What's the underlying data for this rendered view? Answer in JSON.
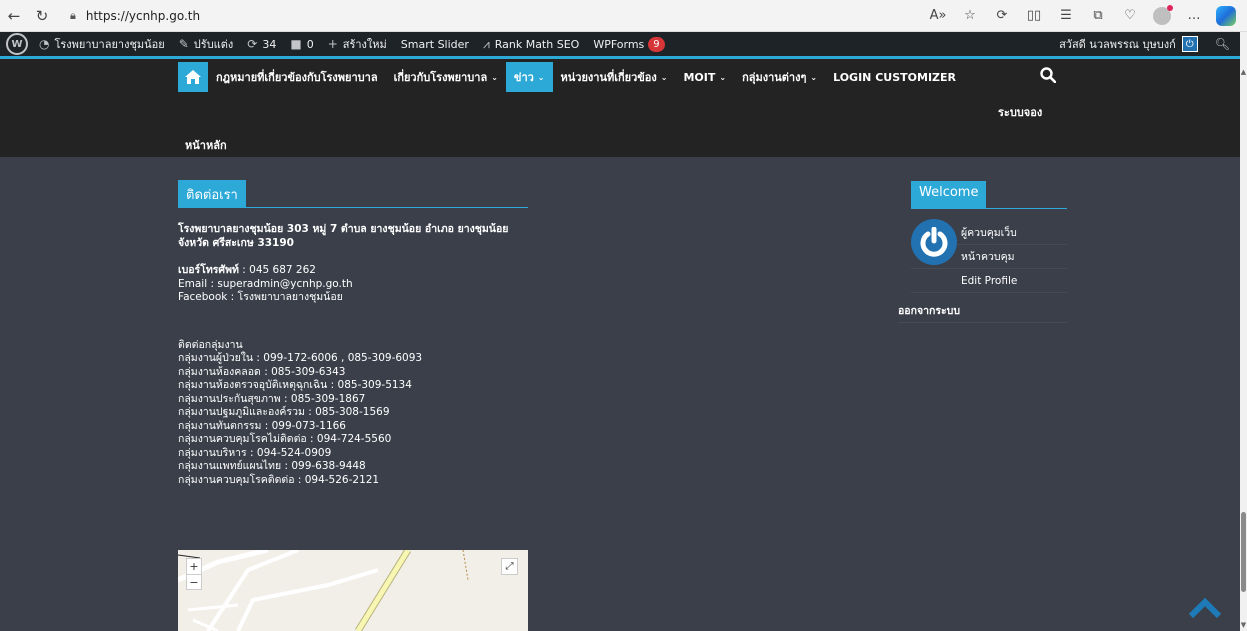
{
  "browser": {
    "url": "https://ycnhp.go.th",
    "back_icon": "back-arrow-icon",
    "reload_icon": "reload-icon"
  },
  "admin_bar": {
    "site_name": "โรงพยาบาลยางชุมน้อย",
    "customize": "ปรับแต่ง",
    "updates_count": "34",
    "comments_count": "0",
    "new": "สร้างใหม่",
    "smart_slider": "Smart Slider",
    "rank_math": "Rank Math SEO",
    "wpforms": "WPForms",
    "wpforms_badge": "9",
    "greeting": "สวัสดี นวลพรรณ บุษบงก์"
  },
  "menu": {
    "items": [
      {
        "label": "กฎหมายที่เกี่ยวข้องกับโรงพยาบาล",
        "chev": ""
      },
      {
        "label": "เกี่ยวกับโรงพยาบาล",
        "chev": "⌄"
      },
      {
        "label": "ข่าว",
        "chev": "⌄"
      },
      {
        "label": "หน่วยงานที่เกี่ยวข้อง",
        "chev": "⌄"
      },
      {
        "label": "MOIT",
        "chev": "⌄"
      },
      {
        "label": "กลุ่มงานต่างๆ",
        "chev": "⌄"
      },
      {
        "label": "LOGIN CUSTOMIZER",
        "chev": ""
      }
    ],
    "row2": "ระบบจอง",
    "row3": "หน้าหลัก"
  },
  "contact": {
    "title": "ติดต่อเรา",
    "address": "โรงพยาบาลยางชุมน้อย 303 หมู่ 7 ตำบล ยางชุมน้อย อำเภอ ยางชุมน้อย จังหวัด ศรีสะเกษ 33190",
    "phone_label": "เบอร์โทรศัพท์",
    "phone": " : 045 687 262",
    "email": "Email : superadmin@ycnhp.go.th",
    "facebook": "Facebook : โรงพยาบาลยางชุมน้อย",
    "groups_title": "ติดต่อกลุ่มงาน",
    "groups": [
      {
        "label": "กลุ่มงานผู้ป่วยใน",
        "value": " : 099-172-6006 , 085-309-6093"
      },
      {
        "label": "กลุ่มงานห้องคลอด",
        "value": " : 085-309-6343"
      },
      {
        "label": "กลุ่มงานห้องตรวจอุบัติเหตุฉุกเฉิน",
        "value": " : 085-309-5134"
      },
      {
        "label": "กลุ่มงานประกันสุขภาพ",
        "value": " : 085-309-1867"
      },
      {
        "label": "กลุ่มงานปฐมภูมิและองค์รวม",
        "value": " : 085-308-1569"
      },
      {
        "label": "กลุ่มงานทันตกรรม",
        "value": " : 099-073-1166"
      },
      {
        "label": "กลุ่มงานควบคุมโรคไม่ติดต่อ",
        "value": " : 094-724-5560"
      },
      {
        "label": "กลุ่มงานบริหาร",
        "value": " : 094-524-0909"
      },
      {
        "label": "กลุ่มงานแพทย์แผนไทย",
        "value": " : 099-638-9448"
      },
      {
        "label": "กลุ่มงานควบคุมโรคติดต่อ",
        "value": " : 094-526-2121"
      }
    ]
  },
  "map": {
    "zoom_in": "+",
    "zoom_out": "−",
    "expand": "⤢"
  },
  "welcome": {
    "title": "Welcome",
    "items": [
      "ผู้ควบคุมเว็บ",
      "หน้าควบคุม",
      "Edit Profile"
    ],
    "logout": "ออกจากระบบ"
  },
  "colors": {
    "accent": "#2da9d8",
    "header_bg": "#232323",
    "body_bg": "#3a3f4a",
    "admin_bar_bg": "#1d2327"
  }
}
